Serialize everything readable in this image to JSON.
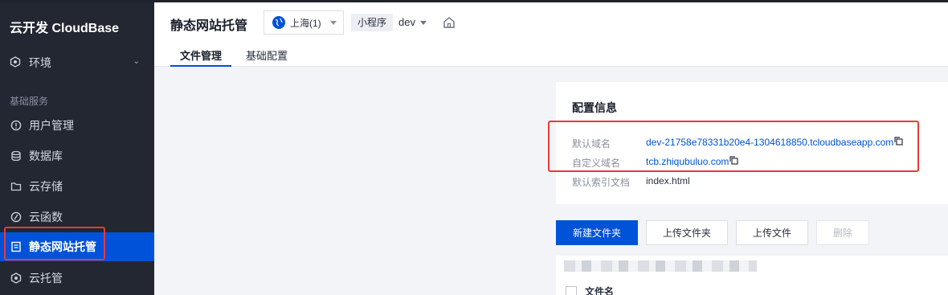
{
  "sidebar": {
    "brand": "云开发 CloudBase",
    "env_label": "环境",
    "section_label": "基础服务",
    "items": [
      {
        "label": "用户管理",
        "icon": "user-icon"
      },
      {
        "label": "数据库",
        "icon": "database-icon"
      },
      {
        "label": "云存储",
        "icon": "folder-icon"
      },
      {
        "label": "云函数",
        "icon": "function-icon"
      },
      {
        "label": "静态网站托管",
        "icon": "document-icon",
        "active": true
      },
      {
        "label": "云托管",
        "icon": "hexagon-icon"
      }
    ]
  },
  "header": {
    "title": "静态网站托管",
    "region": "上海(1)",
    "mini_tag": "小程序",
    "env": "dev",
    "tabs": [
      {
        "label": "文件管理",
        "active": true
      },
      {
        "label": "基础配置",
        "active": false
      }
    ]
  },
  "config": {
    "title": "配置信息",
    "default_domain_label": "默认域名",
    "default_domain_value": "dev-21758e78331b20e4-1304618850.tcloudbaseapp.com",
    "custom_domain_label": "自定义域名",
    "custom_domain_value": "tcb.zhiqubuluo.com",
    "index_doc_label": "默认索引文档",
    "index_doc_value": "index.html"
  },
  "actions": {
    "new_folder": "新建文件夹",
    "upload_folder": "上传文件夹",
    "upload_file": "上传文件",
    "delete": "删除"
  },
  "table": {
    "col_filename": "文件名"
  },
  "colors": {
    "sidebar_bg": "#222732",
    "accent": "#0052d9",
    "highlight_box": "#e63a3a"
  }
}
